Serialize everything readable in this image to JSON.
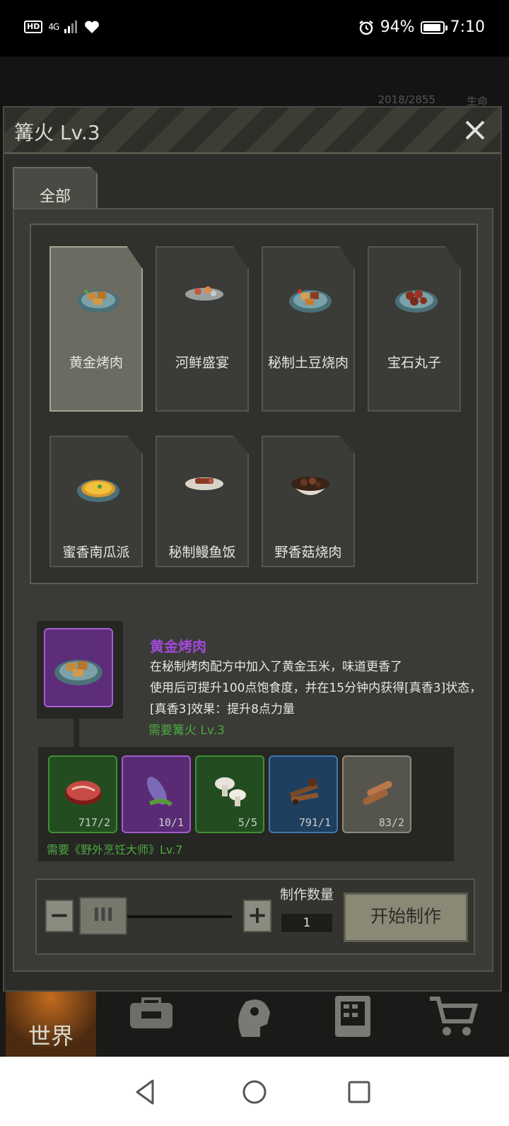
{
  "status_bar": {
    "hd_label": "HD",
    "network_label": "4G",
    "battery_percent": "94%",
    "battery_level": 0.94,
    "time": "7:10"
  },
  "background_info": {
    "counter": "2018/2855",
    "label": "生命"
  },
  "dialog": {
    "title": "篝火 Lv.3",
    "close_icon": "close-icon",
    "tabs": [
      {
        "label": "全部"
      }
    ]
  },
  "recipes": [
    {
      "name": "黄金烤肉",
      "icon": "roast-meat-icon",
      "selected": true
    },
    {
      "name": "河鲜盛宴",
      "icon": "seafood-pot-icon",
      "selected": false
    },
    {
      "name": "秘制土豆烧肉",
      "icon": "potato-meat-icon",
      "selected": false
    },
    {
      "name": "宝石丸子",
      "icon": "meatball-icon",
      "selected": false
    },
    {
      "name": "蜜香南瓜派",
      "icon": "pumpkin-pie-icon",
      "selected": false
    },
    {
      "name": "秘制鳗鱼饭",
      "icon": "eel-rice-icon",
      "selected": false
    },
    {
      "name": "野香菇烧肉",
      "icon": "mushroom-meat-icon",
      "selected": false
    }
  ],
  "detail": {
    "title": "黄金烤肉",
    "lines": [
      "在秘制烤肉配方中加入了黄金玉米，味道更香了",
      "使用后可提升100点饱食度，并在15分钟内获得[真香3]状态，",
      "[真香3]效果：提升8点力量"
    ],
    "requirement": "需要篝火 Lv.3"
  },
  "materials": [
    {
      "icon": "steak-icon",
      "count": "717/2",
      "rarity": "green"
    },
    {
      "icon": "corn-icon",
      "count": "10/1",
      "rarity": "purple"
    },
    {
      "icon": "mushroom-icon",
      "count": "5/5",
      "rarity": "green"
    },
    {
      "icon": "spices-icon",
      "count": "791/1",
      "rarity": "blue"
    },
    {
      "icon": "firewood-icon",
      "count": "83/2",
      "rarity": "gray"
    }
  ],
  "materials_requirement": "需要《野外烹饪大师》Lv.7",
  "controls": {
    "minus_label": "−",
    "plus_label": "+",
    "handle_label": "III",
    "quantity_label": "制作数量",
    "quantity_value": "1",
    "start_label": "开始制作"
  },
  "game_nav": {
    "world_label": "世界",
    "icons": [
      "backpack-icon",
      "head-icon",
      "phone-icon",
      "cart-icon"
    ]
  },
  "android_nav": [
    "back-icon",
    "home-icon",
    "recents-icon"
  ]
}
